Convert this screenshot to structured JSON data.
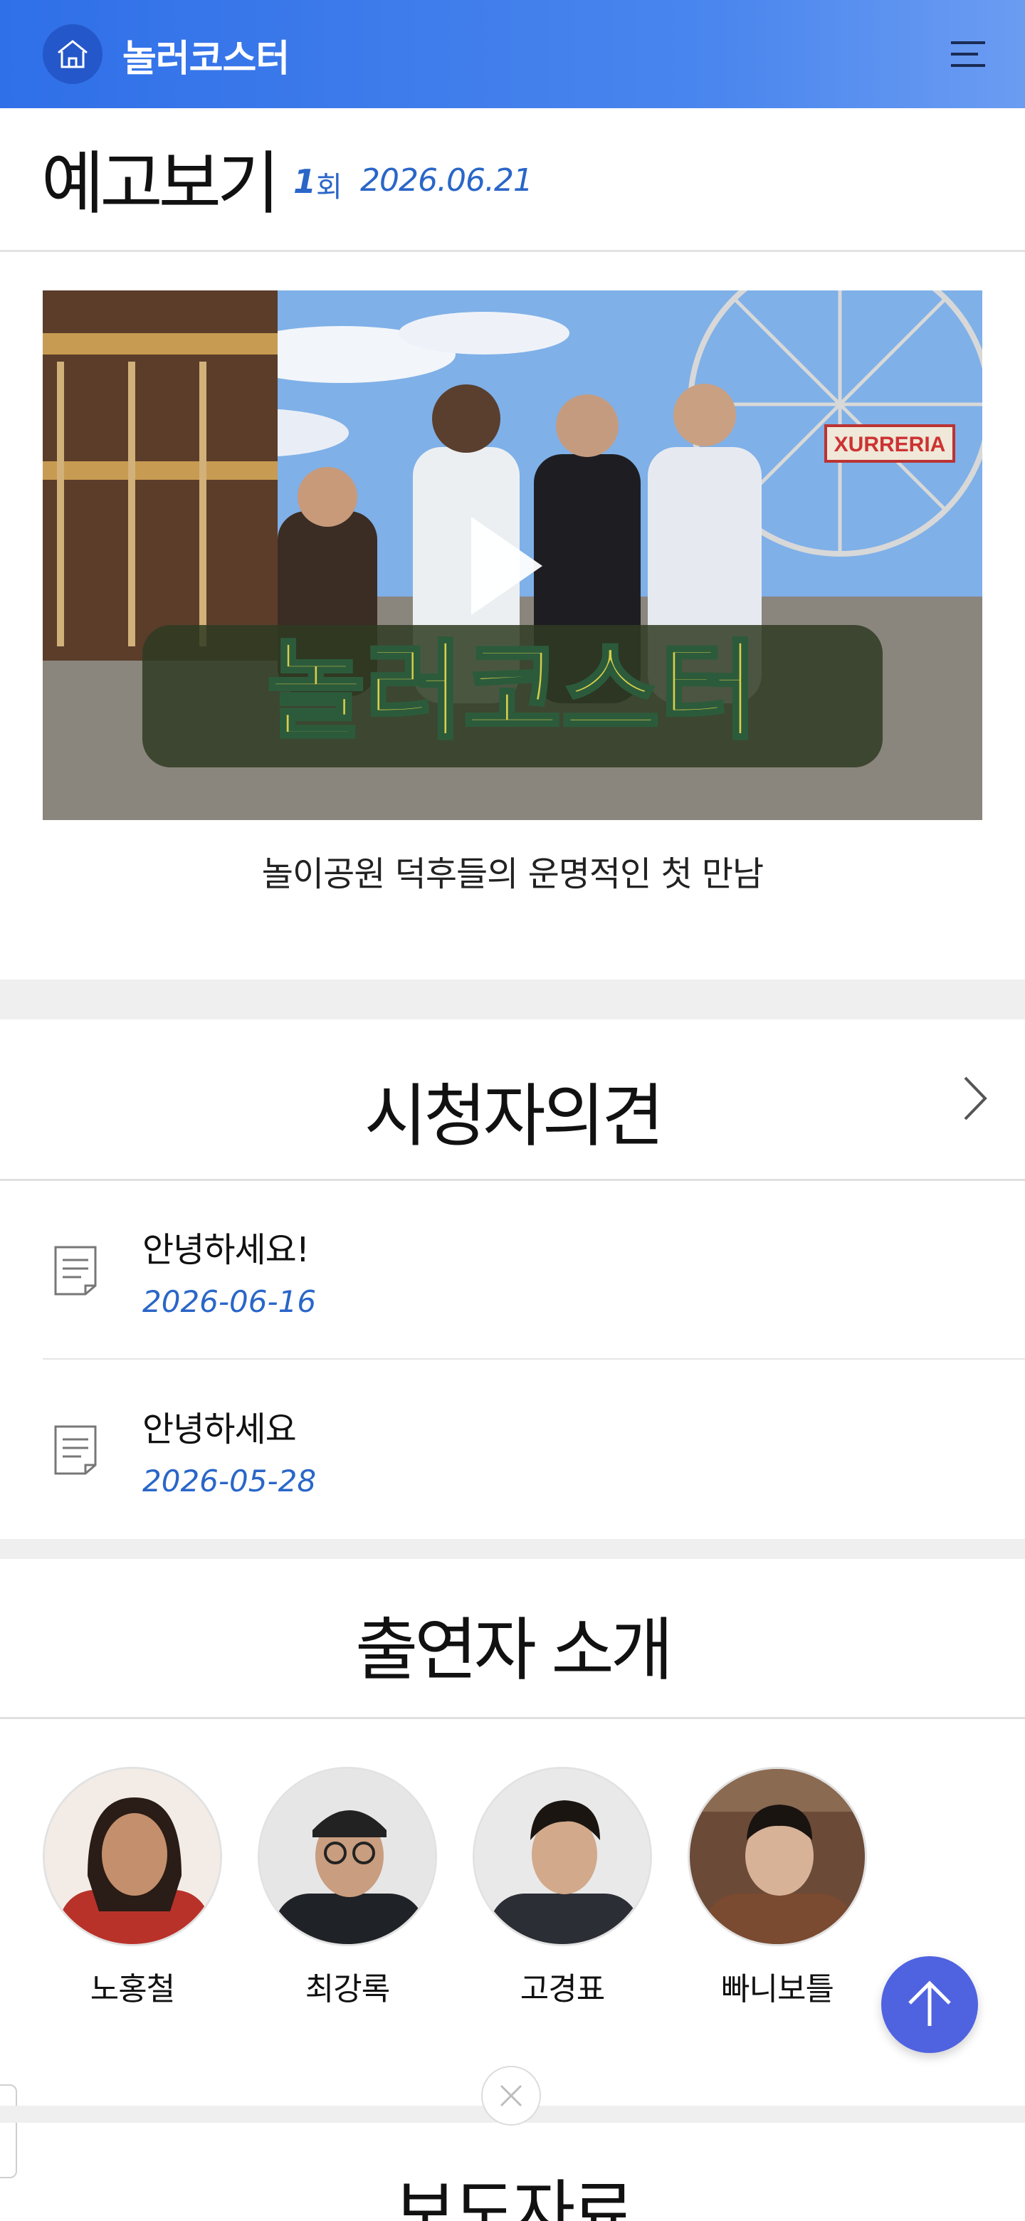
{
  "header": {
    "brand": "놀러코스터",
    "home_icon": "home-icon",
    "menu_icon": "hamburger-icon"
  },
  "preview": {
    "title": "예고보기",
    "episode_number": "1",
    "episode_unit": "회",
    "air_date": "2026.06.21",
    "video_caption": "놀이공원 덕후들의 운명적인 첫 만남",
    "video_logo_text": "놀러코스터",
    "sign_text": "XURRERIA"
  },
  "opinions": {
    "heading": "시청자의견",
    "posts": [
      {
        "title": "안녕하세요!",
        "date": "2026-06-16"
      },
      {
        "title": "안녕하세요",
        "date": "2026-05-28"
      }
    ]
  },
  "cast": {
    "heading": "출연자 소개",
    "members": [
      {
        "name": "노홍철"
      },
      {
        "name": "최강록"
      },
      {
        "name": "고경표"
      },
      {
        "name": "빠니보틀"
      }
    ]
  },
  "press": {
    "heading": "보도자료"
  },
  "colors": {
    "accent": "#2a66c8",
    "header_start": "#2f6fe8",
    "scroll_top": "#4f63e0"
  }
}
